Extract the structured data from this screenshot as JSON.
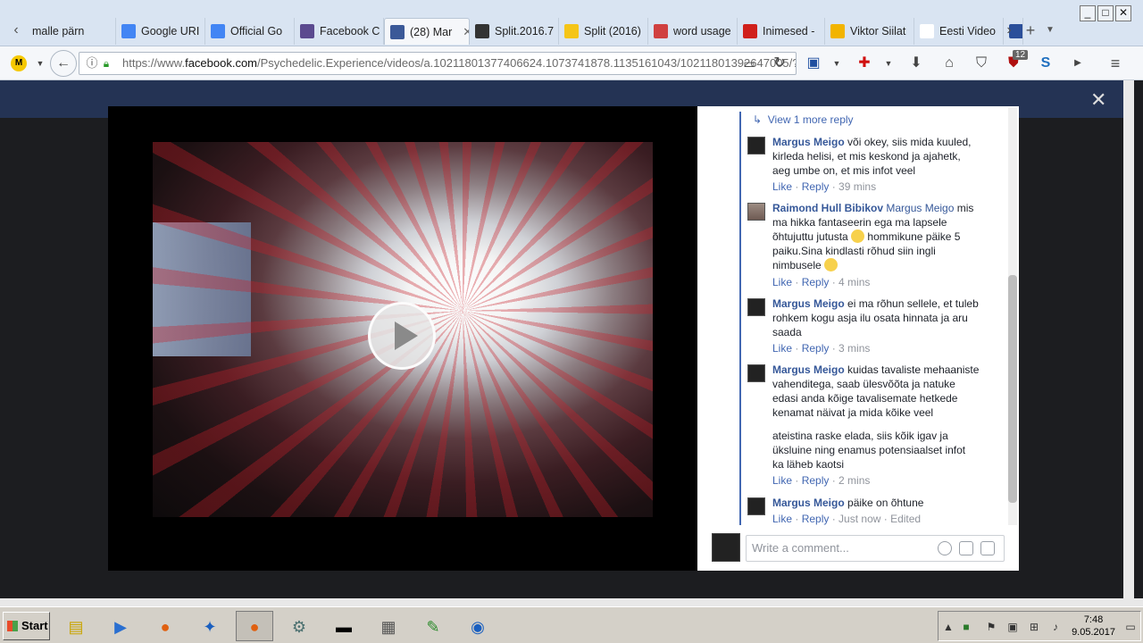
{
  "tabs": [
    {
      "label": "malle pärn",
      "icon": "page-icon",
      "color": "#cccccc"
    },
    {
      "label": "Google URI",
      "icon": "google-icon",
      "color": "#4285f4"
    },
    {
      "label": "Official Go",
      "icon": "google-icon",
      "color": "#4285f4"
    },
    {
      "label": "Facebook C",
      "icon": "grid-icon",
      "color": "#5b4a8f"
    },
    {
      "label": "(28) Mar",
      "icon": "facebook-icon",
      "color": "#3b5998"
    },
    {
      "label": "Split.2016.7",
      "icon": "bus-icon",
      "color": "#333333"
    },
    {
      "label": "Split (2016)",
      "icon": "imdb-icon",
      "color": "#f5c518"
    },
    {
      "label": "word usage",
      "icon": "swirl-icon",
      "color": "#d04040"
    },
    {
      "label": "Inimesed -",
      "icon": "a-icon",
      "color": "#d0201b"
    },
    {
      "label": "Viktor Siilat",
      "icon": "sun-icon",
      "color": "#f2b400"
    },
    {
      "label": "Eesti Video",
      "icon": "wiki-icon",
      "color": "#ffffff"
    },
    {
      "label": "",
      "icon": "doc-icon",
      "color": "#2b4f9a"
    }
  ],
  "url": {
    "prefix": "https://www.",
    "domain": "facebook.com",
    "path": "/Psychedelic.Experience/videos/a.10211801377406624.1073741878.1135161043/10211801392647005/?"
  },
  "addon_badge": "12",
  "comments": {
    "view_more": "View 1 more reply",
    "items": [
      {
        "author": "Margus Meigo",
        "mention": "",
        "text": "või okey, siis mida kuuled, kirleda helisi, et mis keskond ja ajahetk, aeg umbe on, et mis infot veel",
        "like": "Like",
        "reply": "Reply",
        "time": "39 mins",
        "edited": ""
      },
      {
        "author": "Raimond Hull Bibikov",
        "mention": "Margus Meigo",
        "text": "mis ma hikka fantaseerin ega ma lapsele õhtujuttu jutusta",
        "text2": "hommikune päike 5 paiku.Sina kindlasti rõhud siin ingli nimbusele",
        "like": "Like",
        "reply": "Reply",
        "time": "4 mins",
        "edited": ""
      },
      {
        "author": "Margus Meigo",
        "mention": "",
        "text": "ei ma rõhun sellele, et tuleb rohkem kogu asja ilu osata hinnata ja aru saada",
        "like": "Like",
        "reply": "Reply",
        "time": "3 mins",
        "edited": ""
      },
      {
        "author": "Margus Meigo",
        "mention": "",
        "text": "kuidas tavaliste mehaaniste vahenditega, saab ülesvõõta ja natuke edasi anda kõige tavalisemate hetkede kenamat näivat ja mida kõike veel",
        "text2": "ateistina raske elada, siis kõik igav ja üksluine ning enamus potensiaalset infot ka läheb kaotsi",
        "like": "Like",
        "reply": "Reply",
        "time": "2 mins",
        "edited": ""
      },
      {
        "author": "Margus Meigo",
        "mention": "",
        "text": "päike on õhtune",
        "like": "Like",
        "reply": "Reply",
        "time": "Just now",
        "edited": "Edited"
      }
    ],
    "write_placeholder": "Write a comment..."
  },
  "taskbar": {
    "start": "Start",
    "time": "7:48",
    "date": "9.05.2017"
  }
}
